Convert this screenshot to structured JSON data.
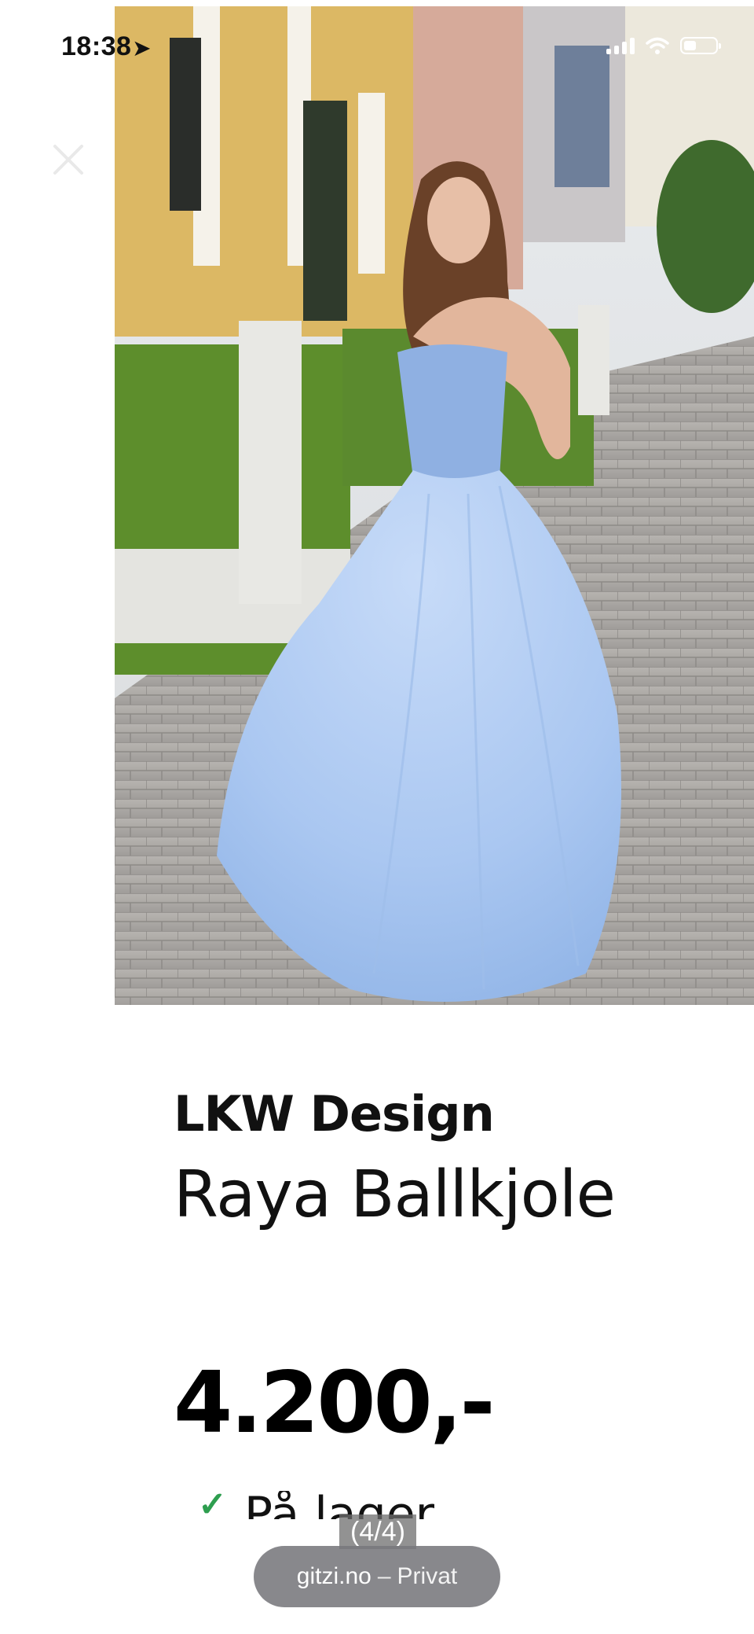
{
  "status_bar": {
    "time": "18:38",
    "location_arrow": "location-arrow-icon"
  },
  "close_icon": "close-icon",
  "product": {
    "brand": "LKW Design",
    "name": "Raya Ballkjole",
    "price": "4.200,-",
    "stock_check_icon": "checkmark-icon",
    "stock_label": "På lager",
    "image_alt": "Blue ball gown on a street"
  },
  "gallery": {
    "counter": "(4/4)"
  },
  "browser": {
    "domain": "gitzi.no",
    "separator": "–",
    "mode": "Privat"
  },
  "colors": {
    "dress": "#a9c6f2",
    "hedge": "#5f8f2f",
    "check": "#2e9e4f"
  }
}
